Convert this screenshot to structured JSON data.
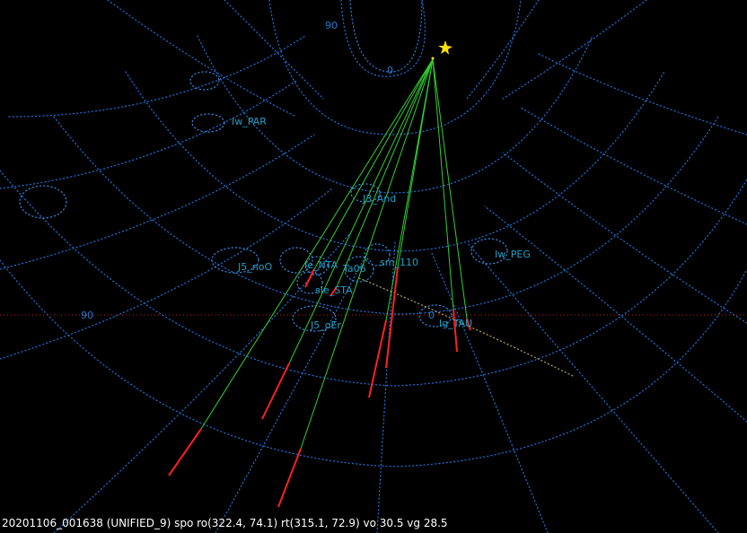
{
  "colors": {
    "background": "#000000",
    "grid": "#1e6fd0",
    "grid_label": "#1c7fd6",
    "station_label": "#1fa0c8",
    "track": "#30d030",
    "meteor": "#ff2020",
    "radiant": "#ffe000",
    "horizon": "#c02020",
    "status_text": "#ffffff"
  },
  "grid_labels": {
    "top_90": "90",
    "top_0": "0",
    "left_90": "90",
    "right_0": "0"
  },
  "stations": [
    {
      "name": "Iw_PAR"
    },
    {
      "name": "J3_And"
    },
    {
      "name": "J5_noO"
    },
    {
      "name": "Ie_NTA"
    },
    {
      "name": "Ta06"
    },
    {
      "name": "sm_110"
    },
    {
      "name": "Iw_PEG"
    },
    {
      "name": "sIe_STA"
    },
    {
      "name": "J5_oEr"
    },
    {
      "name": "Ig_TAU"
    }
  ],
  "status_line": "20201106_001638 (UNIFIED_9) spo ro(322.4, 74.1) rt(315.1, 72.9) vo 30.5 vg 28.5"
}
